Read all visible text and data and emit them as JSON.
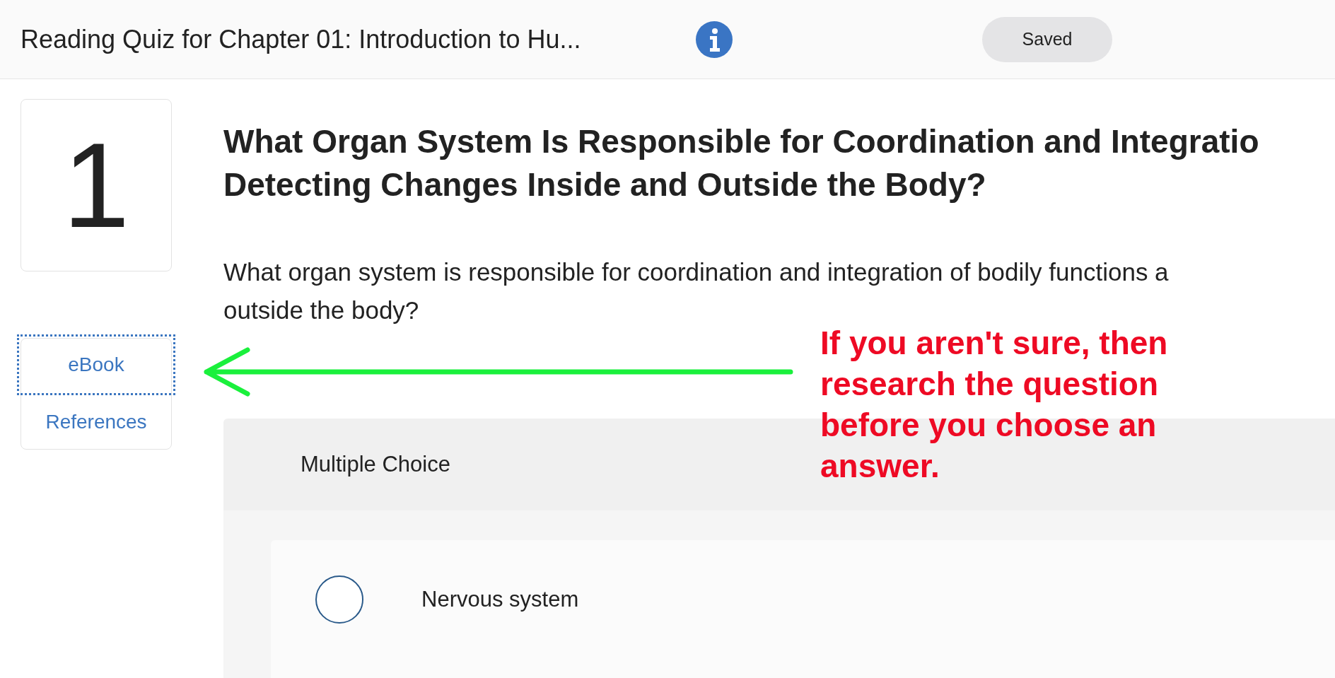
{
  "header": {
    "title": "Reading Quiz for Chapter 01: Introduction to Hu...",
    "status": "Saved"
  },
  "question": {
    "number": "1",
    "title_lines": [
      "What Organ System Is Responsible for Coordination and Integratio",
      "Detecting Changes Inside and Outside the Body?"
    ],
    "prompt_lines": [
      "What organ system is responsible for coordination and integration of bodily functions a",
      "outside the body?"
    ]
  },
  "resources": [
    {
      "label": "eBook",
      "focused": true
    },
    {
      "label": "References",
      "focused": false
    }
  ],
  "answer": {
    "type": "Multiple Choice",
    "options": [
      {
        "label": "Nervous system",
        "selected": false
      }
    ]
  },
  "annotation": {
    "lines": [
      "If you aren't sure, then",
      "research the question",
      "before you choose an",
      "answer."
    ]
  }
}
